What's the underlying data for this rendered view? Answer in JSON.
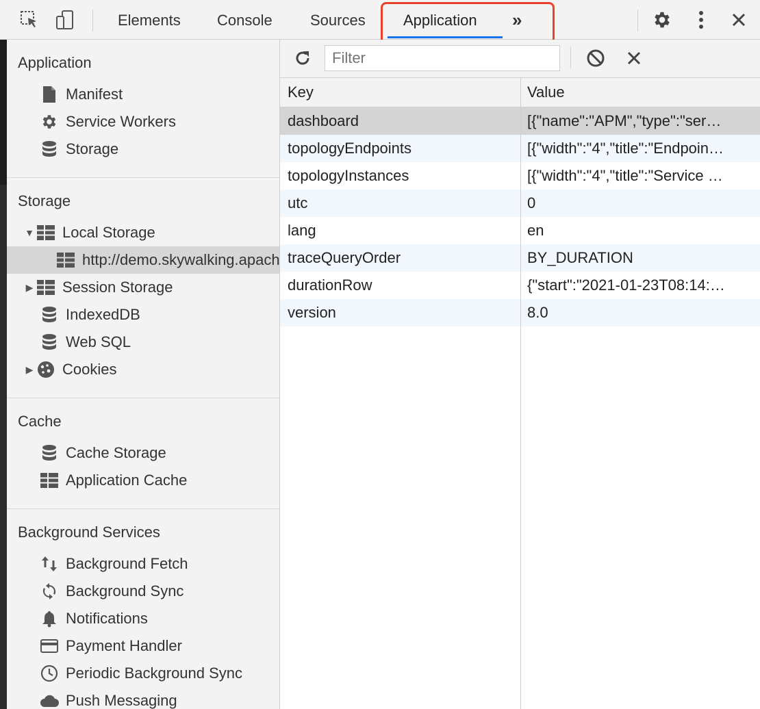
{
  "devtools": {
    "tabs": [
      {
        "label": "Elements"
      },
      {
        "label": "Console"
      },
      {
        "label": "Sources"
      },
      {
        "label": "Application"
      }
    ],
    "more_tabs_glyph": "»"
  },
  "sidebar": {
    "sections": [
      {
        "title": "Application",
        "items": [
          {
            "label": "Manifest",
            "icon": "document-icon"
          },
          {
            "label": "Service Workers",
            "icon": "gear-icon"
          },
          {
            "label": "Storage",
            "icon": "database-icon"
          }
        ]
      },
      {
        "title": "Storage",
        "items": [
          {
            "label": "Local Storage",
            "icon": "grid-icon",
            "expanded": true
          },
          {
            "label": "http://demo.skywalking.apache.org",
            "icon": "grid-icon",
            "selected": true
          },
          {
            "label": "Session Storage",
            "icon": "grid-icon",
            "expanded": false
          },
          {
            "label": "IndexedDB",
            "icon": "database-icon"
          },
          {
            "label": "Web SQL",
            "icon": "database-icon"
          },
          {
            "label": "Cookies",
            "icon": "cookie-icon",
            "expanded": false
          }
        ]
      },
      {
        "title": "Cache",
        "items": [
          {
            "label": "Cache Storage",
            "icon": "database-icon"
          },
          {
            "label": "Application Cache",
            "icon": "grid-icon"
          }
        ]
      },
      {
        "title": "Background Services",
        "items": [
          {
            "label": "Background Fetch",
            "icon": "updown-arrows-icon"
          },
          {
            "label": "Background Sync",
            "icon": "sync-icon"
          },
          {
            "label": "Notifications",
            "icon": "bell-icon"
          },
          {
            "label": "Payment Handler",
            "icon": "card-icon"
          },
          {
            "label": "Periodic Background Sync",
            "icon": "clock-icon"
          },
          {
            "label": "Push Messaging",
            "icon": "cloud-icon"
          }
        ]
      }
    ]
  },
  "storage_view": {
    "filter_placeholder": "Filter",
    "columns": {
      "key": "Key",
      "value": "Value"
    },
    "rows": [
      {
        "key": "dashboard",
        "value": "[{\"name\":\"APM\",\"type\":\"ser…"
      },
      {
        "key": "topologyEndpoints",
        "value": "[{\"width\":\"4\",\"title\":\"Endpoin…"
      },
      {
        "key": "topologyInstances",
        "value": "[{\"width\":\"4\",\"title\":\"Service …"
      },
      {
        "key": "utc",
        "value": "0"
      },
      {
        "key": "lang",
        "value": "en"
      },
      {
        "key": "traceQueryOrder",
        "value": "BY_DURATION"
      },
      {
        "key": "durationRow",
        "value": "{\"start\":\"2021-01-23T08:14:…"
      },
      {
        "key": "version",
        "value": "8.0"
      }
    ]
  }
}
